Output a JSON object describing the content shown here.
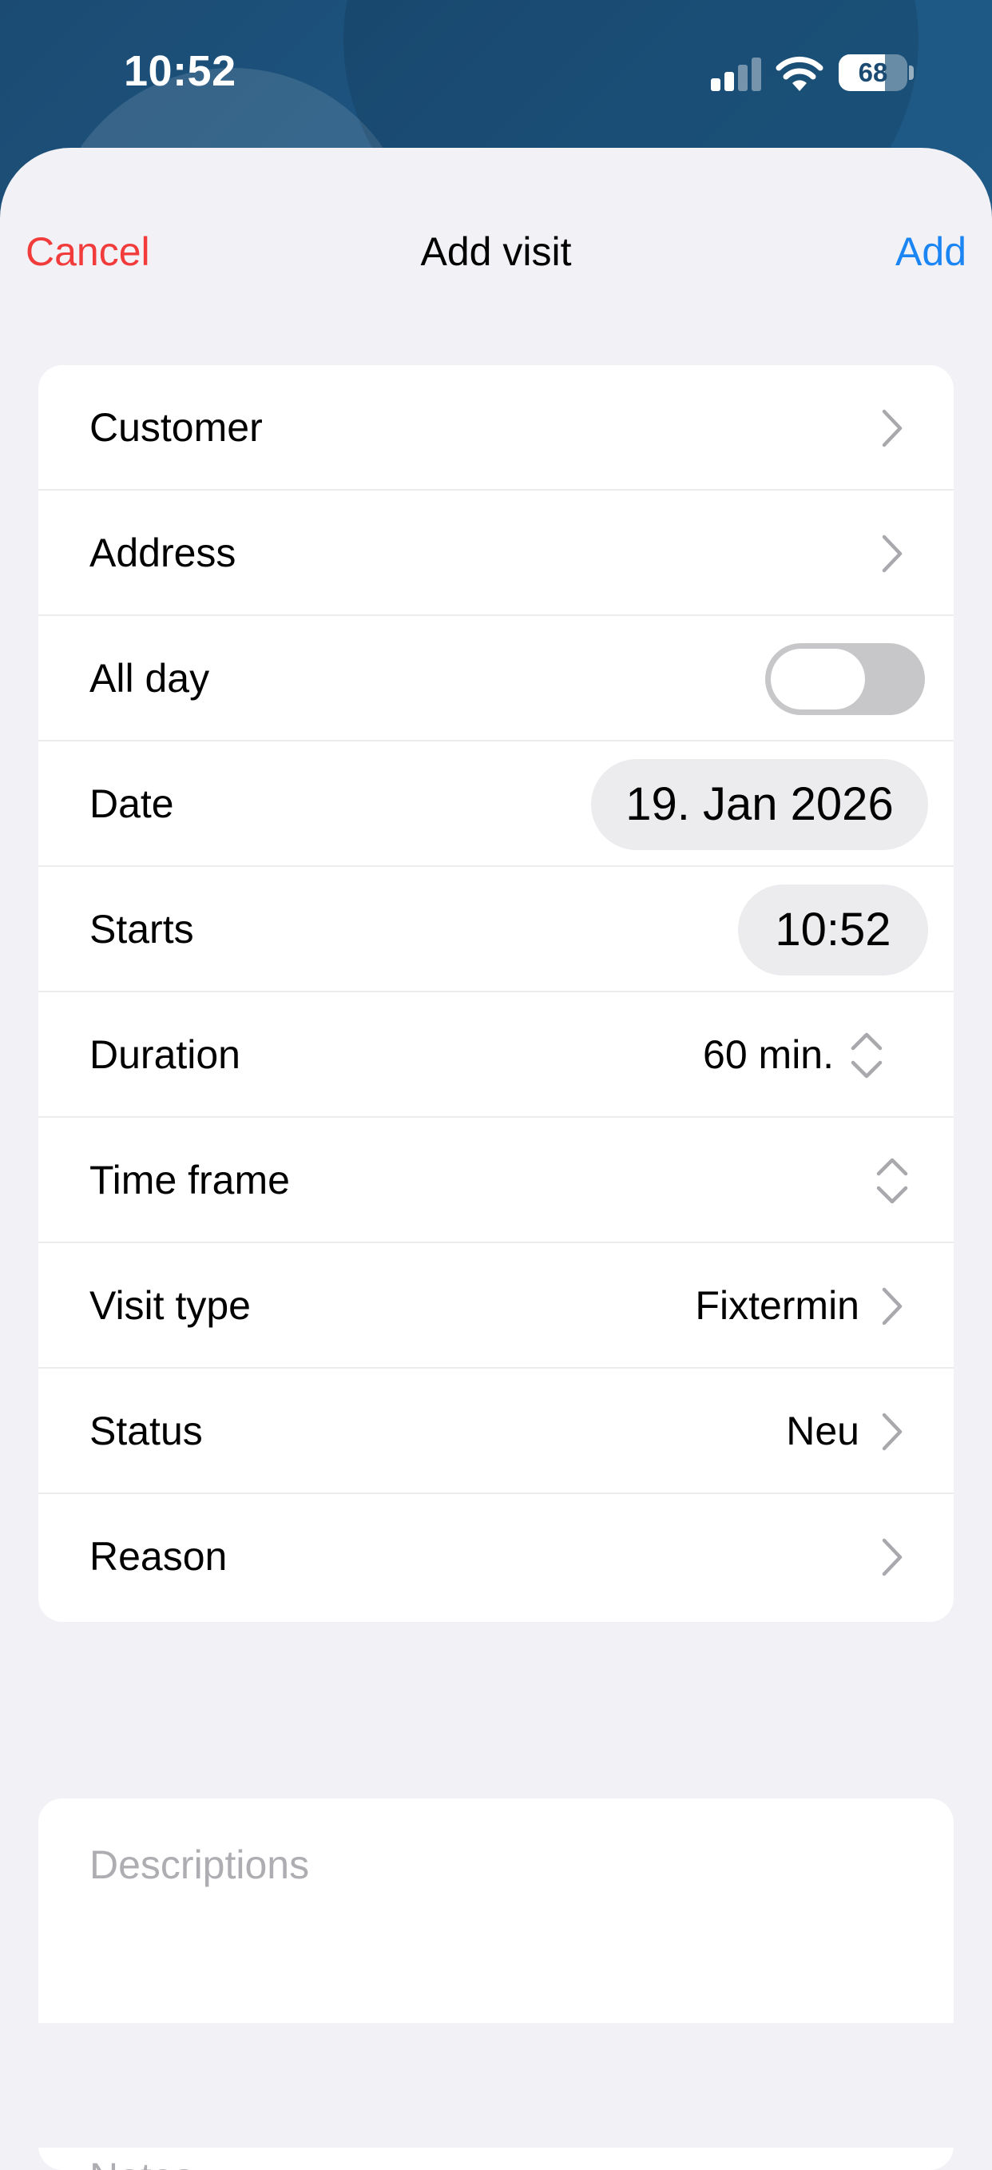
{
  "status_bar": {
    "time": "10:52",
    "battery": "68",
    "battery_level": 0.68
  },
  "nav": {
    "cancel": "Cancel",
    "title": "Add visit",
    "add": "Add"
  },
  "form": {
    "customer": {
      "label": "Customer"
    },
    "address": {
      "label": "Address"
    },
    "all_day": {
      "label": "All day",
      "on": false
    },
    "date": {
      "label": "Date",
      "value": "19. Jan 2026"
    },
    "starts": {
      "label": "Starts",
      "value": "10:52"
    },
    "duration": {
      "label": "Duration",
      "value": "60 min."
    },
    "time_frame": {
      "label": "Time frame",
      "value": ""
    },
    "visit_type": {
      "label": "Visit type",
      "value": "Fixtermin"
    },
    "status": {
      "label": "Status",
      "value": "Neu"
    },
    "reason": {
      "label": "Reason",
      "value": ""
    }
  },
  "descriptions": {
    "placeholder": "Descriptions"
  },
  "notes": {
    "placeholder": "Notes"
  },
  "colors": {
    "header_bg": "#1b4b72",
    "cancel": "#f23b3b",
    "add": "#1a85f3",
    "toggle_off": "#c7c7c9",
    "placeholder": "#aeaeb2"
  },
  "icons": {
    "chevron": "chevron-right-icon",
    "stepper": "up-down-chevron-icon",
    "wifi": "wifi-icon",
    "signal": "cellular-signal-icon",
    "battery": "battery-icon"
  }
}
